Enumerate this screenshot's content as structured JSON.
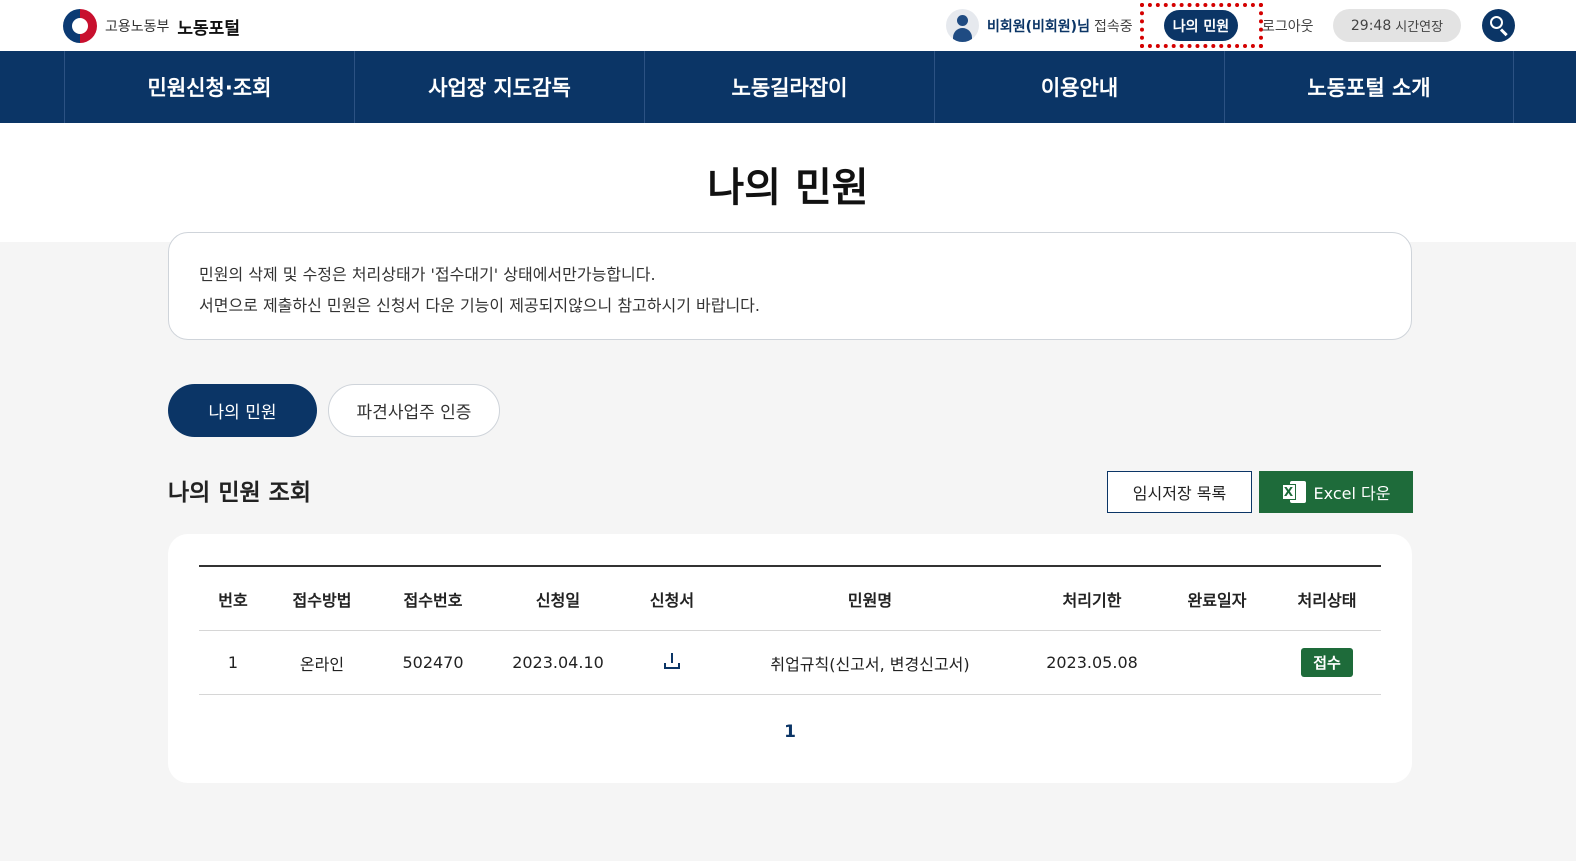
{
  "header": {
    "ministry": "고용노동부",
    "portal": "노동포털",
    "user_name": "비회원(비회원)님",
    "user_status": "접속중",
    "my_civil_button": "나의 민원",
    "logout": "로그아웃",
    "timer": "29:48",
    "timer_extend": "시간연장"
  },
  "nav": [
    "민원신청·조회",
    "사업장 지도감독",
    "노동길라잡이",
    "이용안내",
    "노동포털 소개"
  ],
  "page_title": "나의 민원",
  "notice": {
    "line1": "민원의 삭제 및 수정은 처리상태가 '접수대기' 상태에서만가능합니다.",
    "line2": "서면으로 제출하신 민원은 신청서 다운 기능이 제공되지않으니 참고하시기 바랍니다."
  },
  "tabs": [
    "나의 민원",
    "파견사업주 인증"
  ],
  "section_title": "나의 민원 조회",
  "buttons": {
    "temp_list": "임시저장 목록",
    "excel": "Excel 다운"
  },
  "table": {
    "headers": [
      "번호",
      "접수방법",
      "접수번호",
      "신청일",
      "신청서",
      "민원명",
      "처리기한",
      "완료일자",
      "처리상태"
    ],
    "rows": [
      {
        "no": "1",
        "method": "온라인",
        "receipt_no": "502470",
        "apply_date": "2023.04.10",
        "name": "취업규칙(신고서, 변경신고서)",
        "deadline": "2023.05.08",
        "completed": "",
        "status": "접수"
      }
    ]
  },
  "pager": {
    "current": "1"
  },
  "colors": {
    "primary": "#0b3566",
    "excel_green": "#1e6b3a",
    "highlight": "#d40000"
  }
}
